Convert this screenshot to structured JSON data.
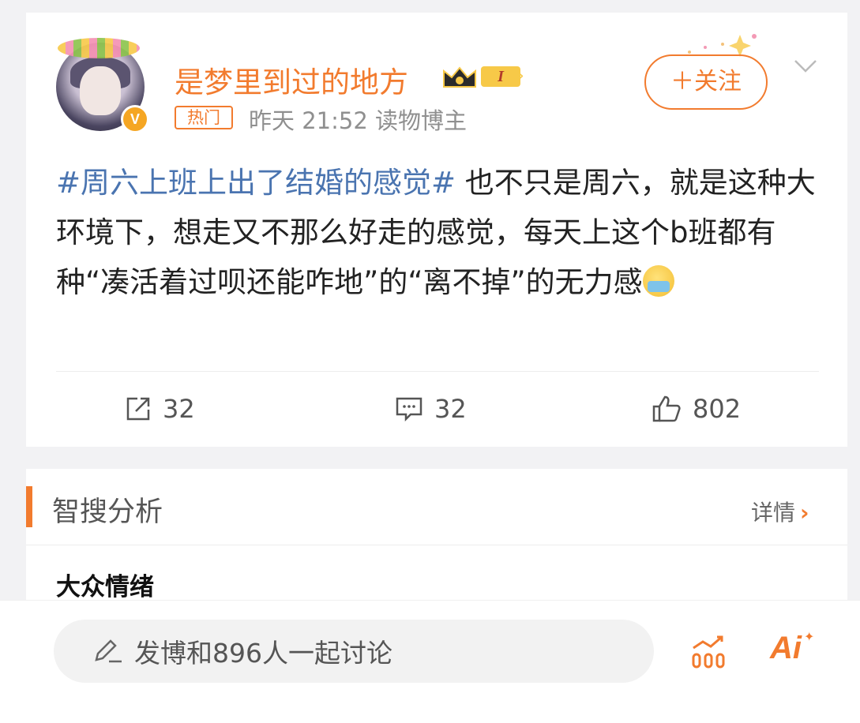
{
  "post": {
    "username": "是梦里到过的地方",
    "level": "I",
    "hot_tag": "热门",
    "meta": "昨天 21:52  读物博主",
    "follow_label": "＋关注",
    "hashtag": "#周六上班上出了结婚的感觉#",
    "body": " 也不只是周六，就是这种大环境下，想走又不那么好走的感觉，每天上这个b班都有种“凑活着过呗还能咋地”的“离不掉”的无力感",
    "actions": {
      "repost_count": "32",
      "comment_count": "32",
      "like_count": "802"
    }
  },
  "analysis": {
    "title": "智搜分析",
    "detail_label": "详情",
    "detail_arrow": "›",
    "sentiment_title": "大众情绪"
  },
  "bottom_bar": {
    "comment_placeholder": "发博和896人一起讨论",
    "ai_label": "Ai"
  },
  "colors": {
    "accent": "#f27b2e",
    "hashtag": "#4a74b0",
    "verified": "#f5a623"
  }
}
